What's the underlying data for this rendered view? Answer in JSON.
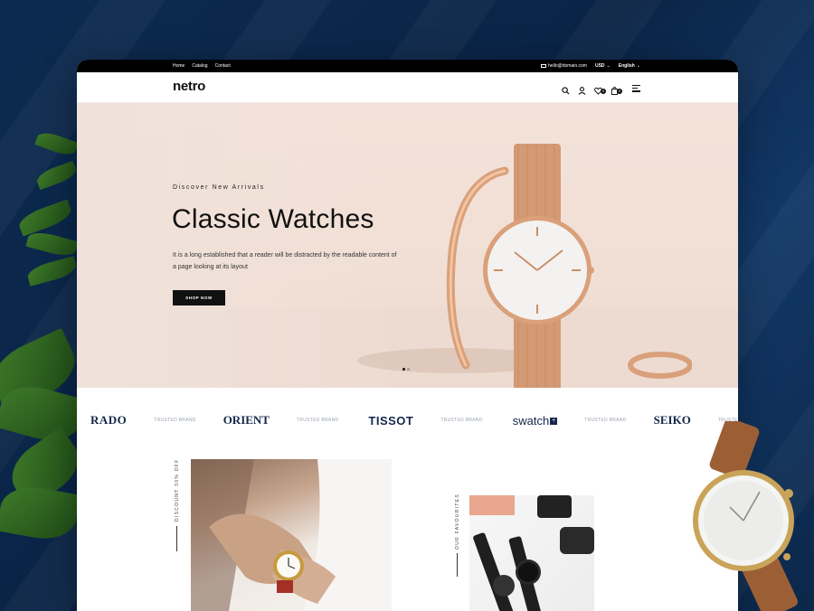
{
  "topbar": {
    "nav": [
      "Home",
      "Catalog",
      "Contact"
    ],
    "email": "hello@domain.com",
    "currency": "USD",
    "language": "English"
  },
  "header": {
    "logo": "netro",
    "icons": [
      "search-icon",
      "user-icon",
      "heart-icon",
      "bag-icon",
      "menu-icon"
    ],
    "wishlist_count": "0",
    "cart_count": "0"
  },
  "hero": {
    "eyebrow": "Discover New Arrivals",
    "title": "Classic Watches",
    "description": "It is a long established that a reader will be distracted by the readable content of a page looking at its layout",
    "button": "SHOP NOW",
    "slides": 2,
    "active_slide": 1
  },
  "brands": {
    "items": [
      "RADO",
      "ORIENT",
      "TISSOT",
      "swatch",
      "SEIKO"
    ],
    "separator": "TRUSTED BRAND"
  },
  "sections": {
    "label1": "DISCOUNT 30% OFF",
    "label2": "OUR FAVOURITES"
  },
  "colors": {
    "accent": "#111111",
    "brand_text": "#14284a",
    "background": "#0c2a50",
    "hero_bg": "#f2e0d6",
    "gold": "#d9a07a"
  }
}
